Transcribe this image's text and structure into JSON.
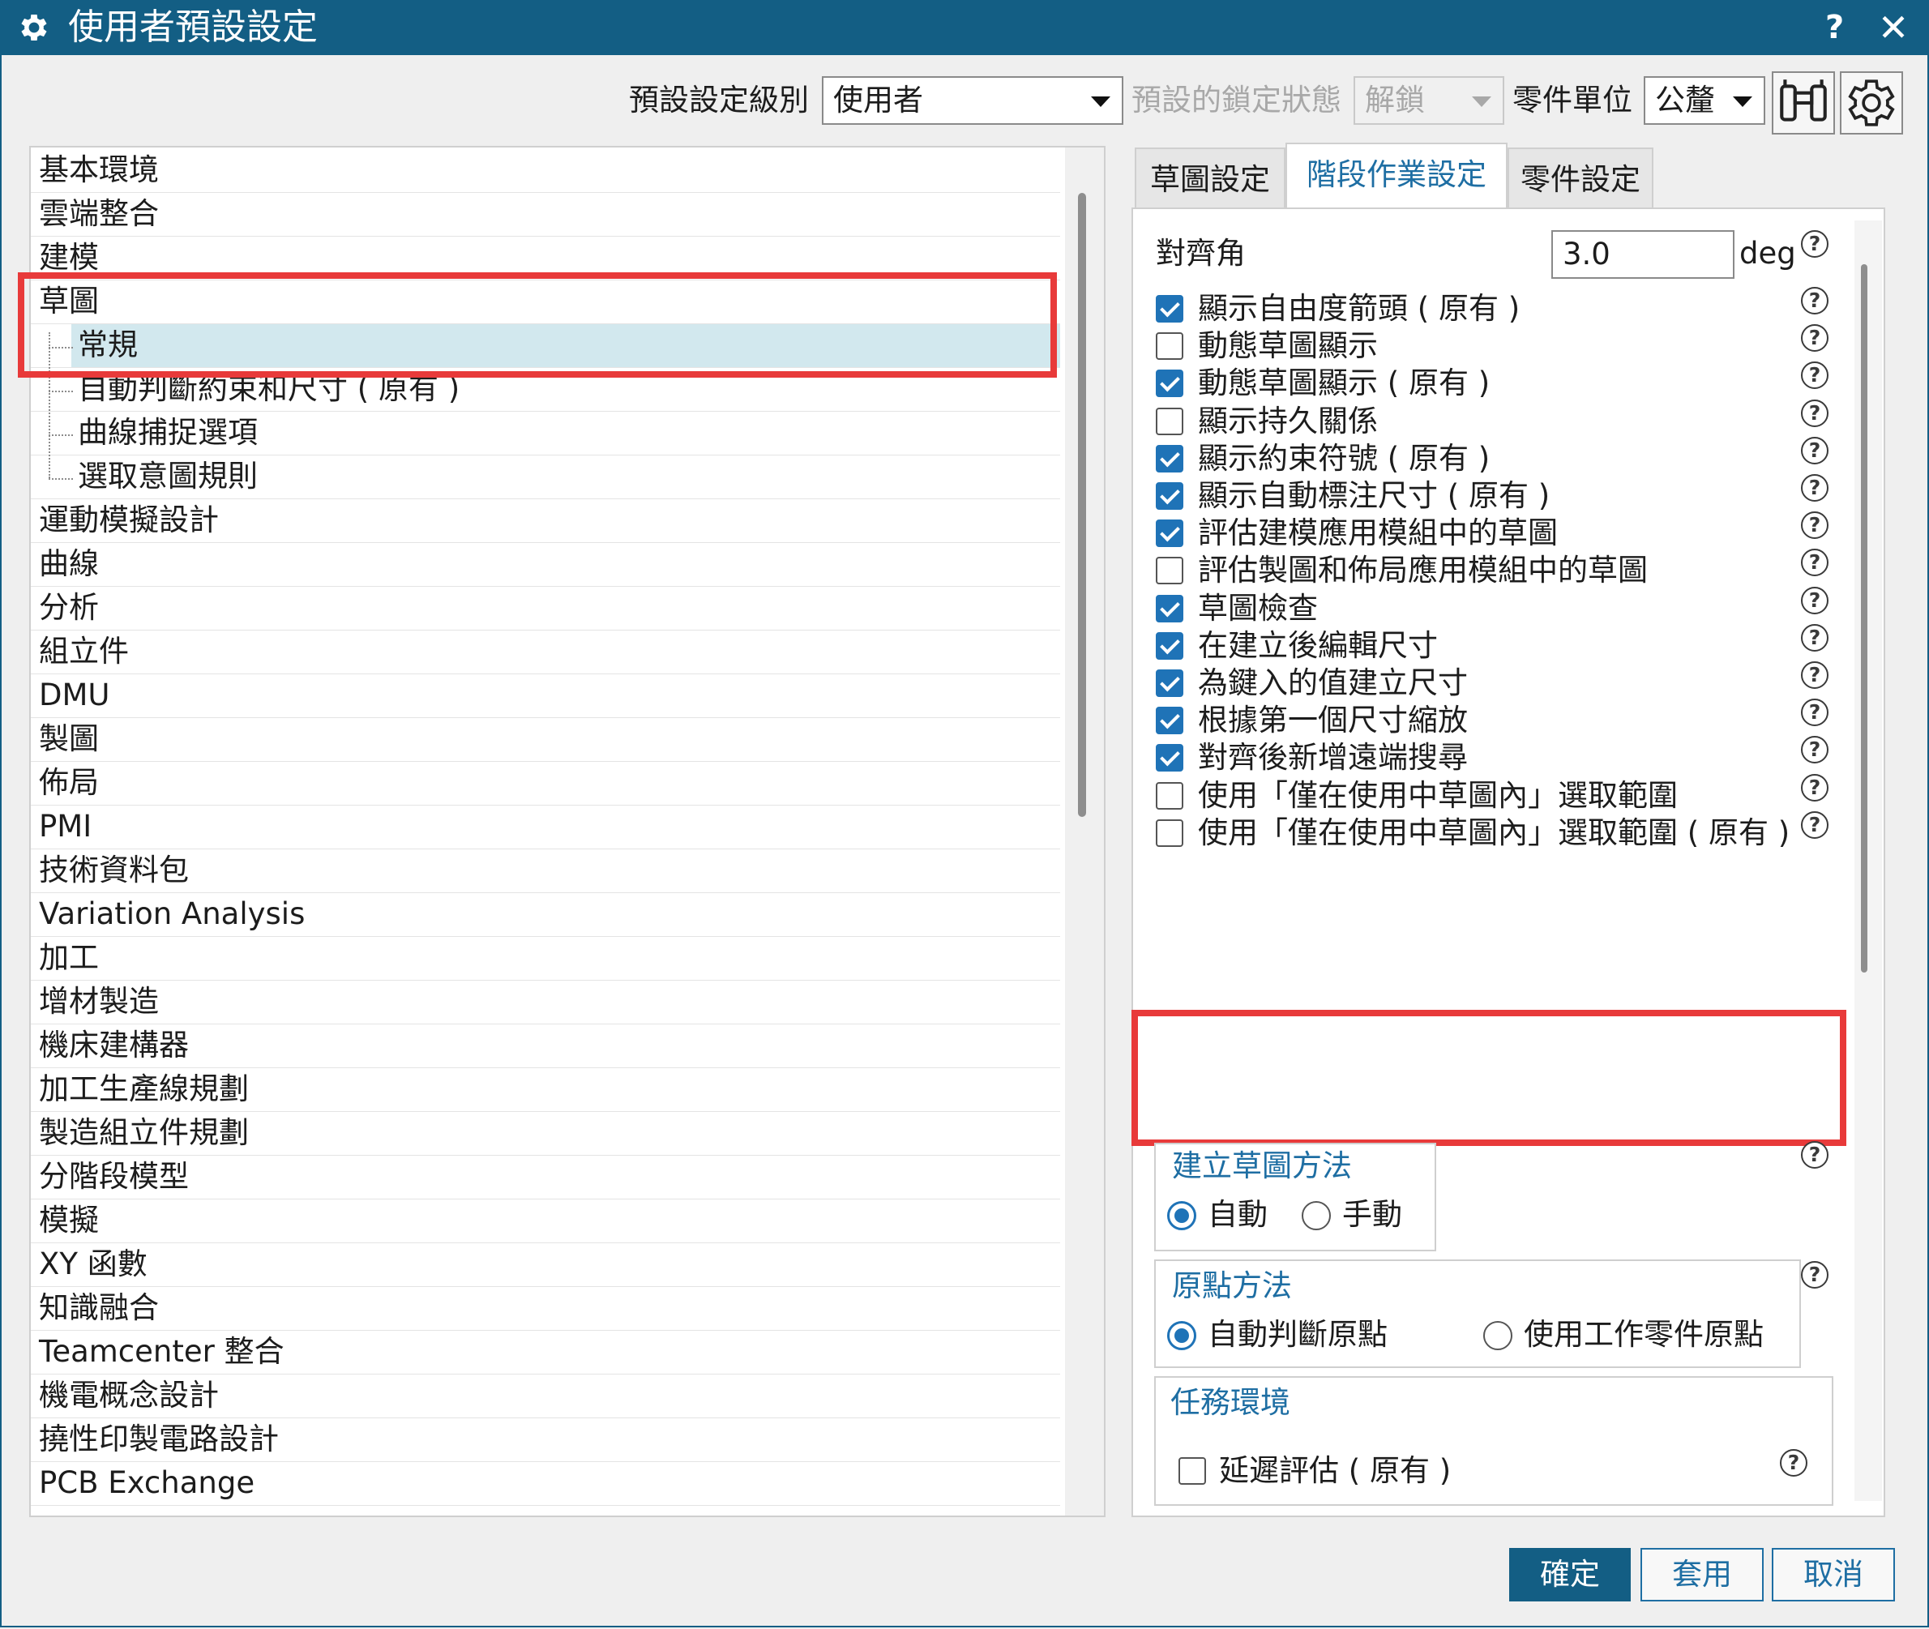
{
  "window": {
    "title": "使用者預設設定",
    "help_label": "?",
    "close_label": "✕"
  },
  "toolbar": {
    "level_label": "預設設定級別",
    "level_value": "使用者",
    "lock_label": "預設的鎖定狀態",
    "lock_value": "解鎖",
    "unit_label": "零件單位",
    "unit_value": "公釐"
  },
  "tree": {
    "items": [
      {
        "label": "基本環境",
        "level": 0
      },
      {
        "label": "雲端整合",
        "level": 0
      },
      {
        "label": "建模",
        "level": 0
      },
      {
        "label": "草圖",
        "level": 0
      },
      {
        "label": "常規",
        "level": 1,
        "selected": true
      },
      {
        "label": "自動判斷約束和尺寸 ( 原有 )",
        "level": 1
      },
      {
        "label": "曲線捕捉選項",
        "level": 1
      },
      {
        "label": "選取意圖規則",
        "level": 1
      },
      {
        "label": "運動模擬設計",
        "level": 0
      },
      {
        "label": "曲線",
        "level": 0
      },
      {
        "label": "分析",
        "level": 0
      },
      {
        "label": "組立件",
        "level": 0
      },
      {
        "label": "DMU",
        "level": 0
      },
      {
        "label": "製圖",
        "level": 0
      },
      {
        "label": "佈局",
        "level": 0
      },
      {
        "label": "PMI",
        "level": 0
      },
      {
        "label": "技術資料包",
        "level": 0
      },
      {
        "label": "Variation Analysis",
        "level": 0
      },
      {
        "label": "加工",
        "level": 0
      },
      {
        "label": "增材製造",
        "level": 0
      },
      {
        "label": "機床建構器",
        "level": 0
      },
      {
        "label": "加工生產線規劃",
        "level": 0
      },
      {
        "label": "製造組立件規劃",
        "level": 0
      },
      {
        "label": "分階段模型",
        "level": 0
      },
      {
        "label": "模擬",
        "level": 0
      },
      {
        "label": "XY 函數",
        "level": 0
      },
      {
        "label": "知識融合",
        "level": 0
      },
      {
        "label": "Teamcenter 整合",
        "level": 0
      },
      {
        "label": "機電概念設計",
        "level": 0
      },
      {
        "label": "撓性印製電路設計",
        "level": 0
      },
      {
        "label": "PCB Exchange",
        "level": 0
      }
    ]
  },
  "tabs": [
    {
      "label": "草圖設定",
      "active": false
    },
    {
      "label": "階段作業設定",
      "active": true
    },
    {
      "label": "零件設定",
      "active": false
    }
  ],
  "settings": {
    "snap_angle": {
      "label": "對齊角",
      "value": "3.0",
      "unit": "deg"
    },
    "help_glyph": "?",
    "options": [
      {
        "label": "顯示自由度箭頭 ( 原有 )",
        "checked": true
      },
      {
        "label": "動態草圖顯示",
        "checked": false
      },
      {
        "label": "動態草圖顯示 ( 原有 )",
        "checked": true
      },
      {
        "label": "顯示持久關係",
        "checked": false
      },
      {
        "label": "顯示約束符號 ( 原有 )",
        "checked": true
      },
      {
        "label": "顯示自動標注尺寸 ( 原有 )",
        "checked": true
      },
      {
        "label": "評估建模應用模組中的草圖",
        "checked": true
      },
      {
        "label": "評估製圖和佈局應用模組中的草圖",
        "checked": false
      },
      {
        "label": "草圖檢查",
        "checked": true
      },
      {
        "label": "在建立後編輯尺寸",
        "checked": true
      },
      {
        "label": "為鍵入的值建立尺寸",
        "checked": true
      },
      {
        "label": "根據第一個尺寸縮放",
        "checked": true
      },
      {
        "label": "對齊後新增遠端搜尋",
        "checked": true
      },
      {
        "label": "使用「僅在使用中草圖內」選取範圍",
        "checked": false
      },
      {
        "label": "使用「僅在使用中草圖內」選取範圍 ( 原有 )",
        "checked": false
      }
    ],
    "sketch_method": {
      "title": "建立草圖方法",
      "options": [
        "自動",
        "手動"
      ],
      "selected": 0
    },
    "origin_method": {
      "title": "原點方法",
      "options": [
        "自動判斷原點",
        "使用工作零件原點"
      ],
      "selected": 0
    },
    "task_env": {
      "title": "任務環境",
      "option": "延遲評估 ( 原有 )",
      "checked": false
    }
  },
  "buttons": {
    "ok": "確定",
    "apply": "套用",
    "cancel": "取消"
  },
  "colors": {
    "titlebar": "#135e84",
    "accent": "#1f73b7",
    "highlight": "#e83a3a",
    "selection": "#d2e8ee"
  }
}
